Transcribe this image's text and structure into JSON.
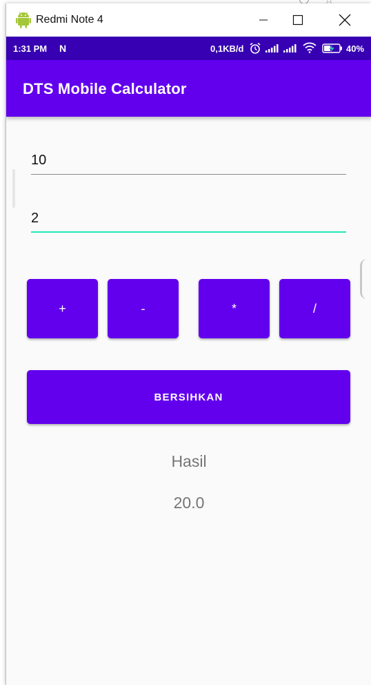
{
  "window": {
    "title": "Redmi Note 4"
  },
  "statusbar": {
    "time": "1:31 PM",
    "notification_icon": "N",
    "network_speed": "0,1KB/d",
    "battery_percent": "40%"
  },
  "appbar": {
    "title": "DTS Mobile Calculator"
  },
  "inputs": {
    "first_value": "10",
    "second_value": "2"
  },
  "operators": {
    "add": "+",
    "subtract": "-",
    "multiply": "*",
    "divide": "/"
  },
  "clear_button": {
    "label": "BERSIHKAN"
  },
  "result": {
    "label": "Hasil",
    "value": "20.0"
  },
  "colors": {
    "status_bar": "#3700b3",
    "app_bar": "#6200ee",
    "button": "#6200ee",
    "focus_underline": "#1de9b6",
    "result_text": "#757575"
  },
  "icons": {
    "window_app": "android-icon",
    "minimize": "minimize-icon",
    "maximize": "maximize-icon",
    "close": "close-icon",
    "alarm": "alarm-icon",
    "signal": "signal-icon",
    "wifi": "wifi-icon",
    "battery": "battery-charging-icon"
  }
}
